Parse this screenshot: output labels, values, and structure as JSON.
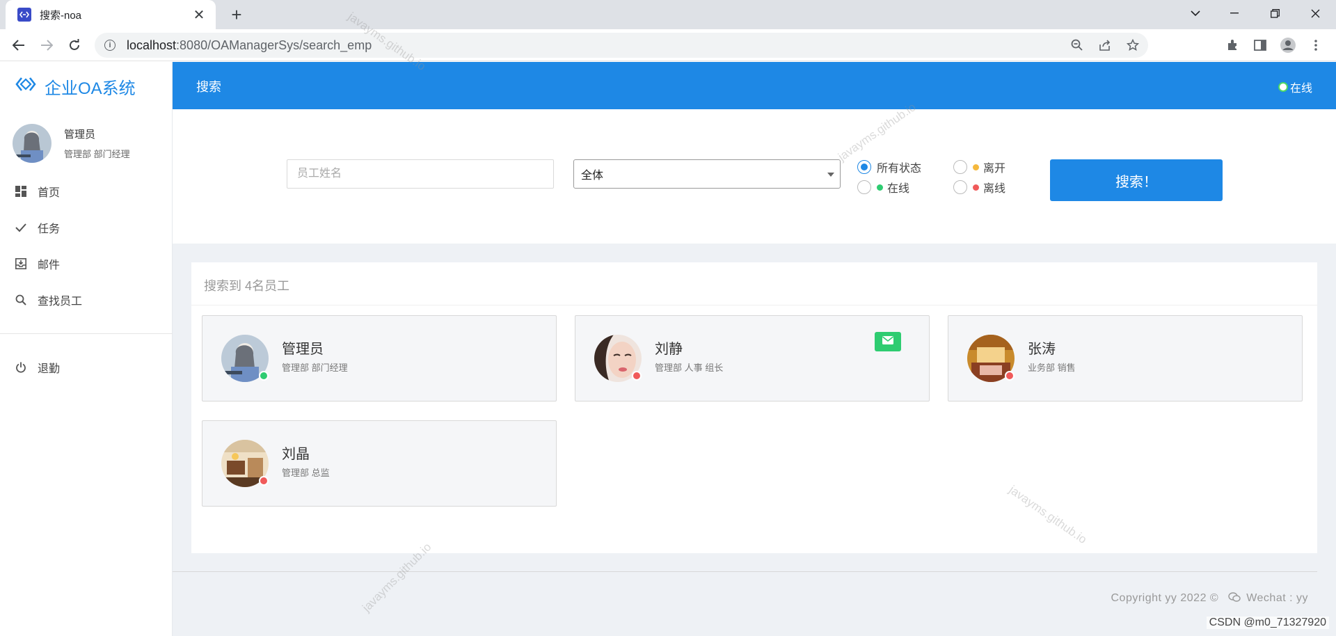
{
  "browser": {
    "tab_title": "搜索-noa",
    "url_host": "localhost",
    "url_rest": ":8080/OAManagerSys/search_emp"
  },
  "sidebar": {
    "brand": "企业OA系统",
    "user_name": "管理员",
    "user_dept": "管理部 部门经理",
    "menu": [
      {
        "label": "首页",
        "icon": "dashboard-icon"
      },
      {
        "label": "任务",
        "icon": "check-icon"
      },
      {
        "label": "邮件",
        "icon": "inbox-icon"
      },
      {
        "label": "查找员工",
        "icon": "search-icon"
      }
    ],
    "logout": "退勤"
  },
  "header": {
    "title": "搜索",
    "status": "在线"
  },
  "search": {
    "name_placeholder": "员工姓名",
    "department_selected": "全体",
    "status_options": [
      {
        "label": "所有状态",
        "checked": true,
        "dot_color": ""
      },
      {
        "label": "离开",
        "checked": false,
        "dot_color": "#f5b83d"
      },
      {
        "label": "在线",
        "checked": false,
        "dot_color": "#2ecc71"
      },
      {
        "label": "离线",
        "checked": false,
        "dot_color": "#f05a5a"
      }
    ],
    "button_label": "搜索！"
  },
  "results": {
    "title": "搜索到 4名员工",
    "employees": [
      {
        "name": "管理员",
        "dept": "管理部 部门经理",
        "status_color": "#2ecc71",
        "has_mail": false
      },
      {
        "name": "刘静",
        "dept": "管理部 人事 组长",
        "status_color": "#f05a5a",
        "has_mail": true
      },
      {
        "name": "张涛",
        "dept": "业务部 销售",
        "status_color": "#f05a5a",
        "has_mail": false
      },
      {
        "name": "刘晶",
        "dept": "管理部 总监",
        "status_color": "#f05a5a",
        "has_mail": false
      }
    ]
  },
  "footer": {
    "copyright": "Copyright yy 2022 ©",
    "wechat": "Wechat : yy"
  },
  "overlay": {
    "csdn_credit": "CSDN @m0_71327920",
    "watermark": "javayms.github.io"
  },
  "colors": {
    "primary": "#1e88e5",
    "online": "#2ecc71",
    "offline": "#f05a5a",
    "away": "#f5b83d"
  }
}
